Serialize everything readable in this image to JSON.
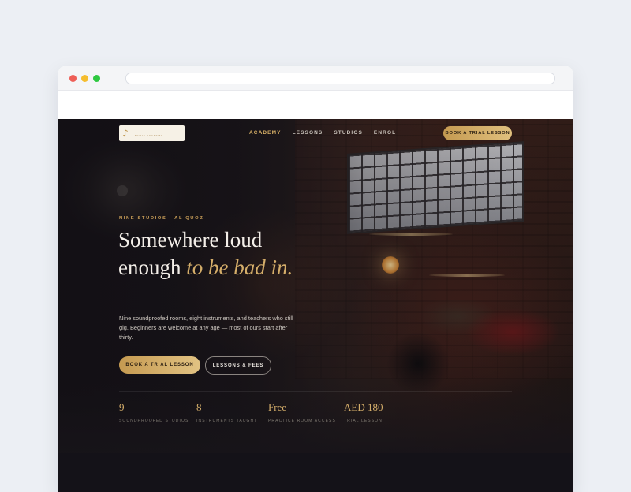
{
  "brand": {
    "logo_text": "Music Academy"
  },
  "nav": {
    "items": [
      {
        "label": "Academy",
        "active": true
      },
      {
        "label": "Lessons",
        "active": false
      },
      {
        "label": "Studios",
        "active": false
      },
      {
        "label": "Enrol",
        "active": false
      }
    ],
    "cta_label": "Book a trial lesson"
  },
  "hero": {
    "eyebrow": "Nine Studios · Al Quoz",
    "title_line_plain": "Somewhere loud enough",
    "title_accent": "to be bad in.",
    "description": "Nine soundproofed rooms, eight instruments, and teachers who still gig. Beginners are welcome at any age — most of ours start after thirty.",
    "primary_button": "Book a trial lesson",
    "secondary_button": "Lessons & fees"
  },
  "stats": [
    {
      "value": "9",
      "label": "Soundproofed studios"
    },
    {
      "value": "8",
      "label": "Instruments taught"
    },
    {
      "value": "Free",
      "label": "Practice room access"
    },
    {
      "value": "AED 180",
      "label": "Trial lesson"
    }
  ],
  "colors": {
    "accent_gold": "#d5ae6a",
    "background_dark": "#171419",
    "page_bg": "#eceff4"
  },
  "icons": {
    "logo_mark": "music-note-icon"
  }
}
